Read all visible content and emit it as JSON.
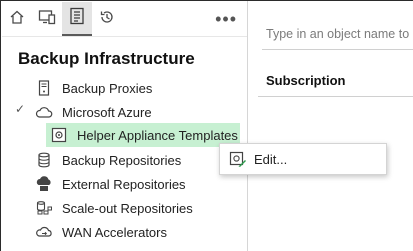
{
  "toolbar": {
    "buttons": [
      {
        "icon": "home-icon"
      },
      {
        "icon": "computer-icon"
      },
      {
        "icon": "inventory-list-icon",
        "active": true
      },
      {
        "icon": "history-icon"
      }
    ],
    "more_label": "•••"
  },
  "panel": {
    "title": "Backup Infrastructure",
    "items": [
      {
        "label": "Backup Proxies",
        "icon": "backup-proxy-icon"
      },
      {
        "label": "Microsoft Azure",
        "icon": "cloud-icon",
        "expanded": true
      },
      {
        "label": "Helper Appliance Templates",
        "icon": "appliance-template-icon",
        "selected": true
      },
      {
        "label": "Backup Repositories",
        "icon": "database-icon"
      },
      {
        "label": "External Repositories",
        "icon": "external-repository-icon"
      },
      {
        "label": "Scale-out Repositories",
        "icon": "scale-out-repository-icon"
      },
      {
        "label": "WAN Accelerators",
        "icon": "wan-accelerator-icon"
      }
    ],
    "expand_glyph": "✓"
  },
  "right": {
    "search_placeholder": "Type in an object name to se",
    "column_header": "Subscription"
  },
  "context_menu": {
    "items": [
      {
        "label": "Edit...",
        "icon": "edit-template-icon"
      }
    ]
  },
  "colors": {
    "selection": "#c7f0d2",
    "accent_green": "#2e9d4f"
  }
}
